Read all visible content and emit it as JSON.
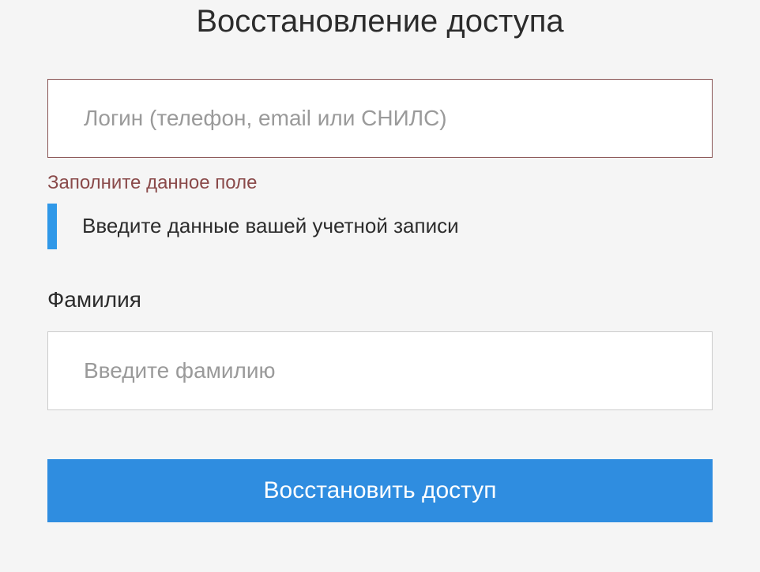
{
  "title": "Восстановление доступа",
  "login": {
    "placeholder": "Логин (телефон, email или СНИЛС)",
    "value": "",
    "error": "Заполните данное поле"
  },
  "info": {
    "text": "Введите данные вашей учетной записи"
  },
  "surname": {
    "label": "Фамилия",
    "placeholder": "Введите фамилию",
    "value": ""
  },
  "submit": {
    "label": "Восстановить доступ"
  }
}
